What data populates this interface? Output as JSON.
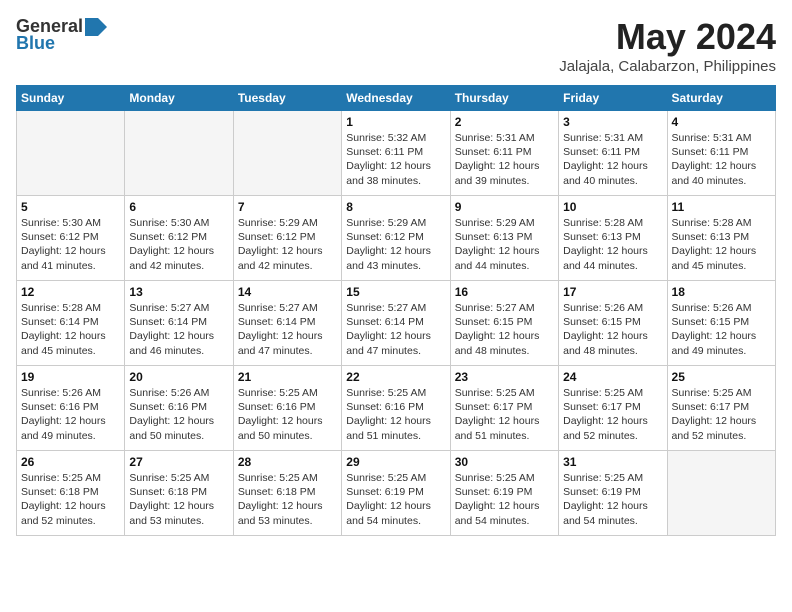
{
  "logo": {
    "general": "General",
    "blue": "Blue"
  },
  "title": "May 2024",
  "subtitle": "Jalajala, Calabarzon, Philippines",
  "headers": [
    "Sunday",
    "Monday",
    "Tuesday",
    "Wednesday",
    "Thursday",
    "Friday",
    "Saturday"
  ],
  "weeks": [
    [
      {
        "day": "",
        "info": ""
      },
      {
        "day": "",
        "info": ""
      },
      {
        "day": "",
        "info": ""
      },
      {
        "day": "1",
        "info": "Sunrise: 5:32 AM\nSunset: 6:11 PM\nDaylight: 12 hours\nand 38 minutes."
      },
      {
        "day": "2",
        "info": "Sunrise: 5:31 AM\nSunset: 6:11 PM\nDaylight: 12 hours\nand 39 minutes."
      },
      {
        "day": "3",
        "info": "Sunrise: 5:31 AM\nSunset: 6:11 PM\nDaylight: 12 hours\nand 40 minutes."
      },
      {
        "day": "4",
        "info": "Sunrise: 5:31 AM\nSunset: 6:11 PM\nDaylight: 12 hours\nand 40 minutes."
      }
    ],
    [
      {
        "day": "5",
        "info": "Sunrise: 5:30 AM\nSunset: 6:12 PM\nDaylight: 12 hours\nand 41 minutes."
      },
      {
        "day": "6",
        "info": "Sunrise: 5:30 AM\nSunset: 6:12 PM\nDaylight: 12 hours\nand 42 minutes."
      },
      {
        "day": "7",
        "info": "Sunrise: 5:29 AM\nSunset: 6:12 PM\nDaylight: 12 hours\nand 42 minutes."
      },
      {
        "day": "8",
        "info": "Sunrise: 5:29 AM\nSunset: 6:12 PM\nDaylight: 12 hours\nand 43 minutes."
      },
      {
        "day": "9",
        "info": "Sunrise: 5:29 AM\nSunset: 6:13 PM\nDaylight: 12 hours\nand 44 minutes."
      },
      {
        "day": "10",
        "info": "Sunrise: 5:28 AM\nSunset: 6:13 PM\nDaylight: 12 hours\nand 44 minutes."
      },
      {
        "day": "11",
        "info": "Sunrise: 5:28 AM\nSunset: 6:13 PM\nDaylight: 12 hours\nand 45 minutes."
      }
    ],
    [
      {
        "day": "12",
        "info": "Sunrise: 5:28 AM\nSunset: 6:14 PM\nDaylight: 12 hours\nand 45 minutes."
      },
      {
        "day": "13",
        "info": "Sunrise: 5:27 AM\nSunset: 6:14 PM\nDaylight: 12 hours\nand 46 minutes."
      },
      {
        "day": "14",
        "info": "Sunrise: 5:27 AM\nSunset: 6:14 PM\nDaylight: 12 hours\nand 47 minutes."
      },
      {
        "day": "15",
        "info": "Sunrise: 5:27 AM\nSunset: 6:14 PM\nDaylight: 12 hours\nand 47 minutes."
      },
      {
        "day": "16",
        "info": "Sunrise: 5:27 AM\nSunset: 6:15 PM\nDaylight: 12 hours\nand 48 minutes."
      },
      {
        "day": "17",
        "info": "Sunrise: 5:26 AM\nSunset: 6:15 PM\nDaylight: 12 hours\nand 48 minutes."
      },
      {
        "day": "18",
        "info": "Sunrise: 5:26 AM\nSunset: 6:15 PM\nDaylight: 12 hours\nand 49 minutes."
      }
    ],
    [
      {
        "day": "19",
        "info": "Sunrise: 5:26 AM\nSunset: 6:16 PM\nDaylight: 12 hours\nand 49 minutes."
      },
      {
        "day": "20",
        "info": "Sunrise: 5:26 AM\nSunset: 6:16 PM\nDaylight: 12 hours\nand 50 minutes."
      },
      {
        "day": "21",
        "info": "Sunrise: 5:25 AM\nSunset: 6:16 PM\nDaylight: 12 hours\nand 50 minutes."
      },
      {
        "day": "22",
        "info": "Sunrise: 5:25 AM\nSunset: 6:16 PM\nDaylight: 12 hours\nand 51 minutes."
      },
      {
        "day": "23",
        "info": "Sunrise: 5:25 AM\nSunset: 6:17 PM\nDaylight: 12 hours\nand 51 minutes."
      },
      {
        "day": "24",
        "info": "Sunrise: 5:25 AM\nSunset: 6:17 PM\nDaylight: 12 hours\nand 52 minutes."
      },
      {
        "day": "25",
        "info": "Sunrise: 5:25 AM\nSunset: 6:17 PM\nDaylight: 12 hours\nand 52 minutes."
      }
    ],
    [
      {
        "day": "26",
        "info": "Sunrise: 5:25 AM\nSunset: 6:18 PM\nDaylight: 12 hours\nand 52 minutes."
      },
      {
        "day": "27",
        "info": "Sunrise: 5:25 AM\nSunset: 6:18 PM\nDaylight: 12 hours\nand 53 minutes."
      },
      {
        "day": "28",
        "info": "Sunrise: 5:25 AM\nSunset: 6:18 PM\nDaylight: 12 hours\nand 53 minutes."
      },
      {
        "day": "29",
        "info": "Sunrise: 5:25 AM\nSunset: 6:19 PM\nDaylight: 12 hours\nand 54 minutes."
      },
      {
        "day": "30",
        "info": "Sunrise: 5:25 AM\nSunset: 6:19 PM\nDaylight: 12 hours\nand 54 minutes."
      },
      {
        "day": "31",
        "info": "Sunrise: 5:25 AM\nSunset: 6:19 PM\nDaylight: 12 hours\nand 54 minutes."
      },
      {
        "day": "",
        "info": ""
      }
    ]
  ]
}
